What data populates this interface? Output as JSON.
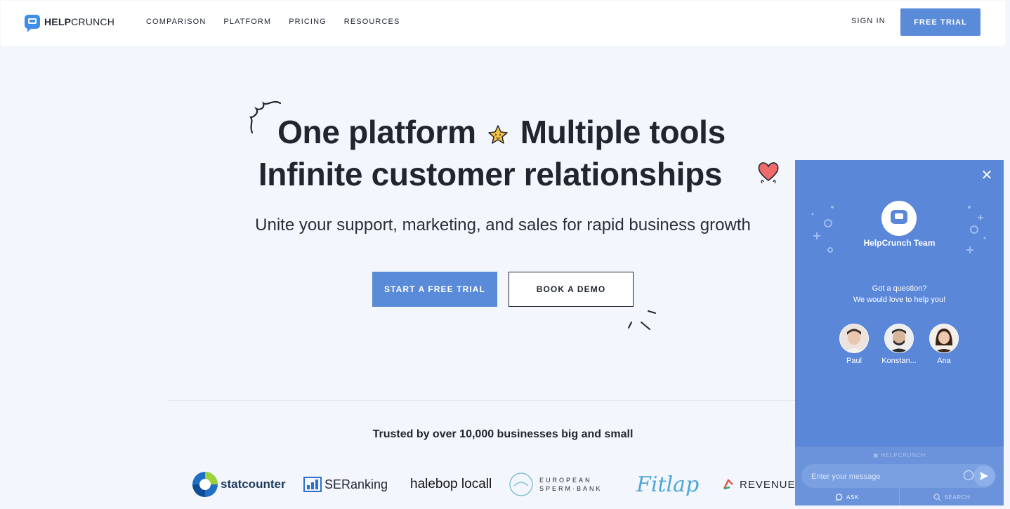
{
  "header": {
    "logo_bold": "HELP",
    "logo_regular": "CRUNCH",
    "nav": [
      "COMPARISON",
      "PLATFORM",
      "PRICING",
      "RESOURCES"
    ],
    "sign_in": "SIGN IN",
    "free_trial": "FREE TRIAL"
  },
  "hero": {
    "line1_a": "One platform",
    "line1_b": "Multiple tools",
    "line2": "Infinite customer relationships",
    "subtitle": "Unite your support, marketing, and sales for rapid business growth",
    "cta_primary": "START A FREE TRIAL",
    "cta_secondary": "BOOK A DEMO"
  },
  "trusted": {
    "title": "Trusted by over 10,000 businesses big and small",
    "brands": [
      "statcounter",
      "SERanking",
      "halebop locall",
      "EUROPEAN SPERM·BANK",
      "Fitlap",
      "REVENUEC"
    ]
  },
  "chat": {
    "team_name": "HelpCrunch Team",
    "question_line1": "Got a question?",
    "question_line2": "We would love to help you!",
    "agents": [
      "Paul",
      "Konstan...",
      "Ana"
    ],
    "powered_by": "HELPCRUNCH",
    "input_placeholder": "Enter your message",
    "tab_ask": "ASK",
    "tab_search": "SEARCH"
  },
  "colors": {
    "accent": "#5a8bd9",
    "widget": "#5b87d9",
    "background": "#f3f7fd"
  }
}
